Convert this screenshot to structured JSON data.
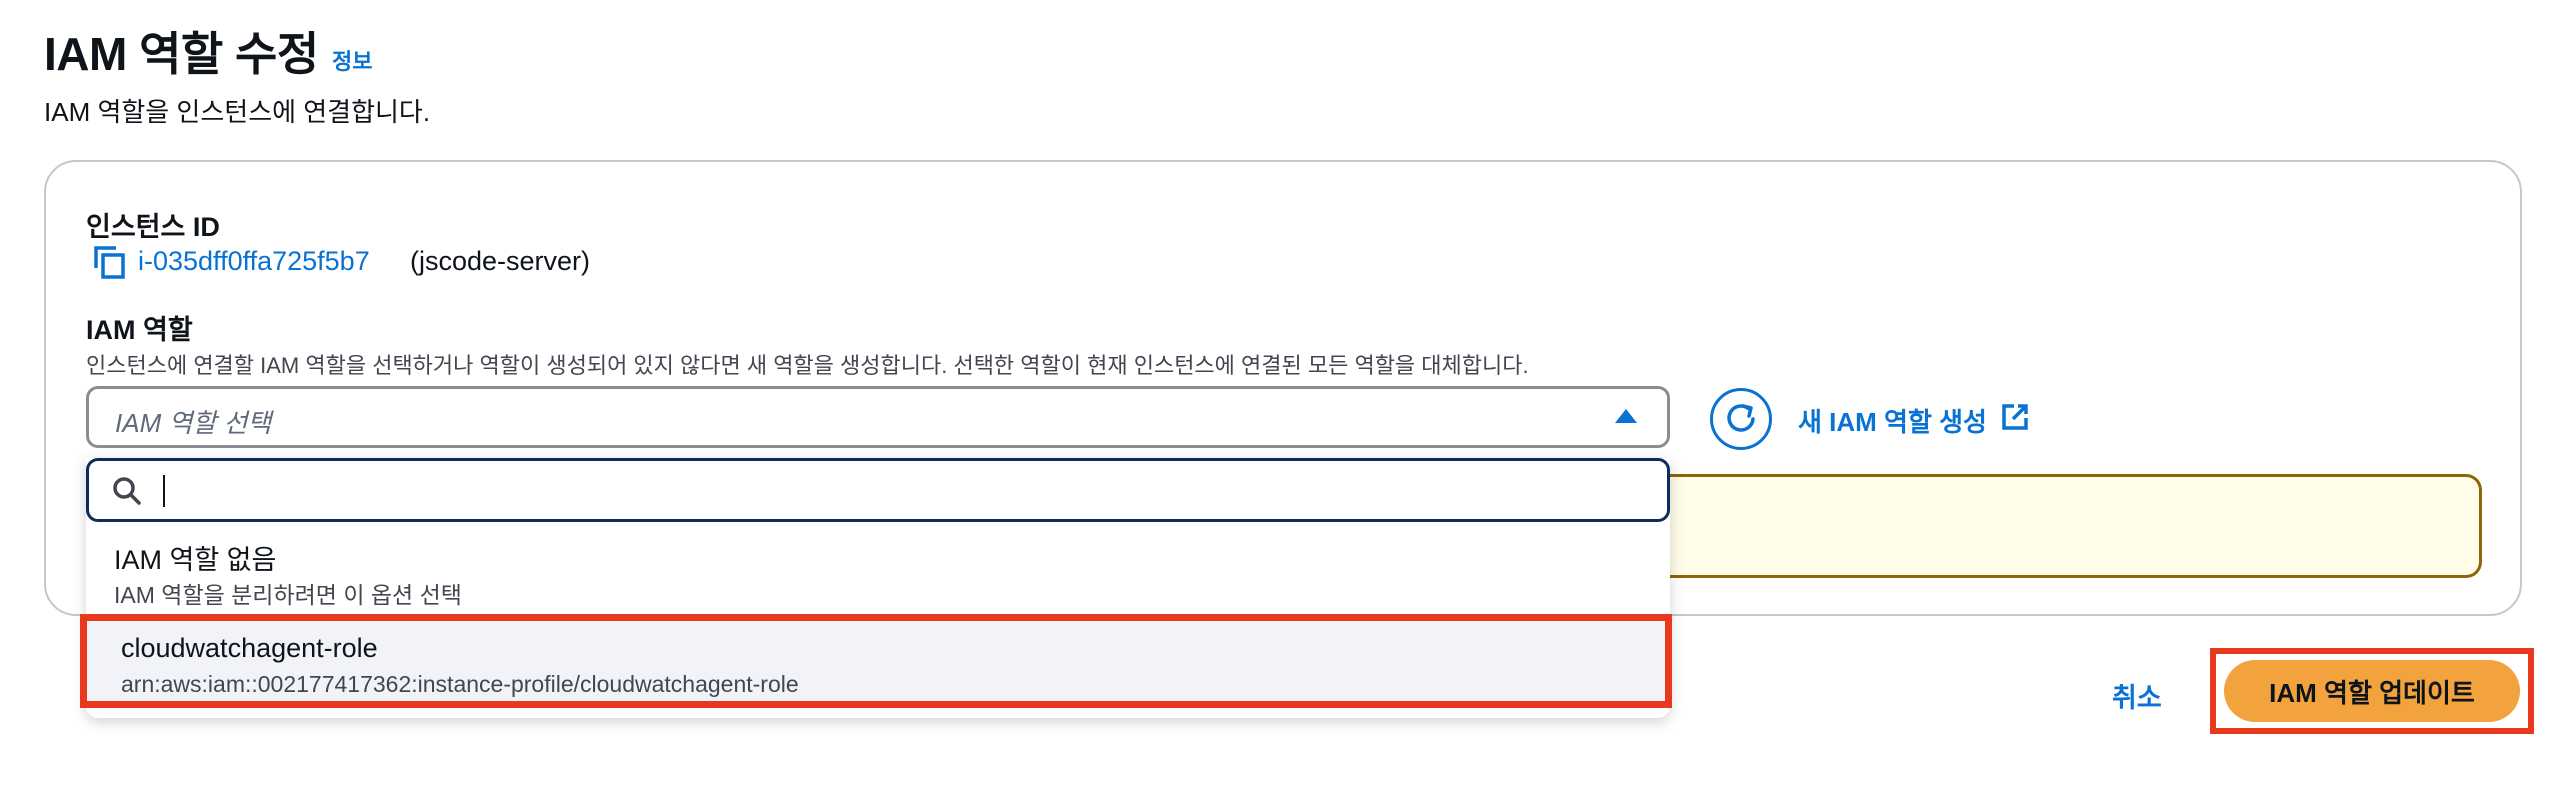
{
  "header": {
    "title": "IAM 역할 수정",
    "info_link": "정보",
    "description": "IAM 역할을 인스턴스에 연결합니다."
  },
  "instance": {
    "label": "인스턴스 ID",
    "id": "i-035dff0ffa725f5b7",
    "name": "(jscode-server)"
  },
  "iam_role": {
    "label": "IAM 역할",
    "description": "인스턴스에 연결할 IAM 역할을 선택하거나 역할이 생성되어 있지 않다면 새 역할을 생성합니다. 선택한 역할이 현재 인스턴스에 연결된 모든 역할을 대체합니다.",
    "select_placeholder": "IAM 역할 선택",
    "create_link": "새 IAM 역할 생성"
  },
  "dropdown": {
    "search_value": "",
    "options": [
      {
        "title": "IAM 역할 없음",
        "subtitle": "IAM 역할을 분리하려면 이 옵션 선택"
      },
      {
        "title": "cloudwatchagent-role",
        "subtitle": "arn:aws:iam::002177417362:instance-profile/cloudwatchagent-role"
      }
    ]
  },
  "actions": {
    "cancel": "취소",
    "update": "IAM 역할 업데이트"
  },
  "colors": {
    "link": "#0972d3",
    "primary_button": "#f3a33d",
    "highlight": "#e8391d",
    "warning_bg": "#fffce9"
  }
}
